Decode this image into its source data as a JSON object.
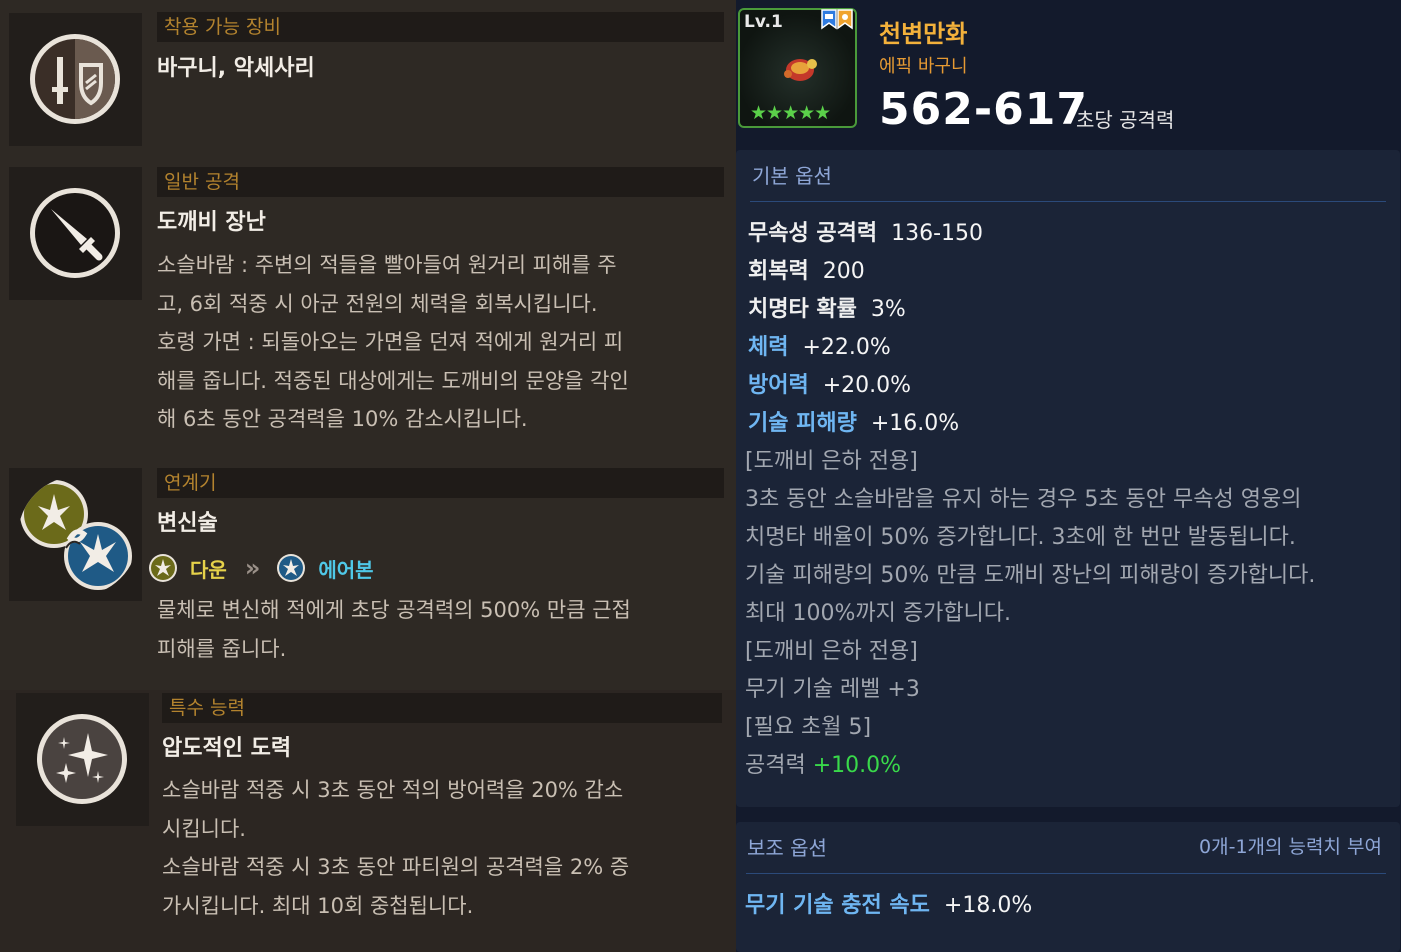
{
  "left": {
    "equip": {
      "header": "착용 가능 장비",
      "title": "바구니, 악세사리"
    },
    "basic_attack": {
      "header": "일반 공격",
      "title": "도깨비 장난",
      "lines": [
        "소슬바람 : 주변의 적들을 빨아들여 원거리 피해를 주",
        "고, 6회 적중 시 아군 전원의 체력을 회복시킵니다.",
        "호령 가면 : 되돌아오는 가면을 던져 적에게 원거리 피",
        "해를 줍니다. 적중된 대상에게는 도깨비의 문양을 각인",
        "해 6초 동안 공격력을 10% 감소시킵니다."
      ]
    },
    "combo": {
      "header": "연계기",
      "title": "변신술",
      "from": "다운",
      "arrow": "»",
      "to": "에어본",
      "lines": [
        "물체로 변신해 적에게 초당 공격력의 500% 만큼 근접",
        "피해를 줍니다."
      ]
    },
    "special": {
      "header": "특수 능력",
      "title": "압도적인 도력",
      "lines": [
        "소슬바람 적중 시 3초 동안 적의 방어력을 20% 감소",
        "시킵니다.",
        "소슬바람 적중 시 3초 동안 파티원의 공격력을 2% 증",
        "가시킵니다. 최대 10회 중첩됩니다."
      ]
    }
  },
  "item": {
    "level": "Lv.1",
    "stars": "★★★★★",
    "name": "천변만화",
    "type": "에픽 바구니",
    "attack": "562-617",
    "attack_label": "초당 공격력"
  },
  "basic_options": {
    "header": "기본 옵션",
    "stats": [
      {
        "key": "무속성 공격력",
        "value": "136-150"
      },
      {
        "key": "회복력",
        "value": "200"
      },
      {
        "key": "치명타 확률",
        "value": "3%"
      },
      {
        "key": "체력",
        "value": "+22.0%"
      },
      {
        "key": "방어력",
        "value": "+20.0%"
      },
      {
        "key": "기술 피해량",
        "value": "+16.0%"
      }
    ],
    "notes": [
      "[도깨비 은하 전용]",
      "3초 동안 소슬바람을 유지 하는 경우 5초 동안 무속성 영웅의",
      "치명타 배율이 50% 증가합니다. 3초에 한 번만 발동됩니다.",
      "기술 피해량의 50% 만큼 도깨비 장난의 피해량이 증가합니다.",
      "최대 100%까지 증가합니다.",
      "[도깨비 은하 전용]",
      "무기 기술 레벨 +3",
      "[필요 초월 5]"
    ],
    "bonus_key": "공격력",
    "bonus_value": "+10.0%"
  },
  "sub_options": {
    "header": "보조 옵션",
    "right_note": "0개-1개의 능력치 부여",
    "stat_key": "무기 기술 충전 속도",
    "stat_value": "+18.0%"
  },
  "colors": {
    "header_gold": "#b3832e",
    "item_name": "#f3b13b",
    "stat_blue": "#6fb6f2",
    "bonus_green": "#39d94a",
    "combo_yellow": "#e6d24a",
    "combo_cyan": "#4fc8e8"
  }
}
